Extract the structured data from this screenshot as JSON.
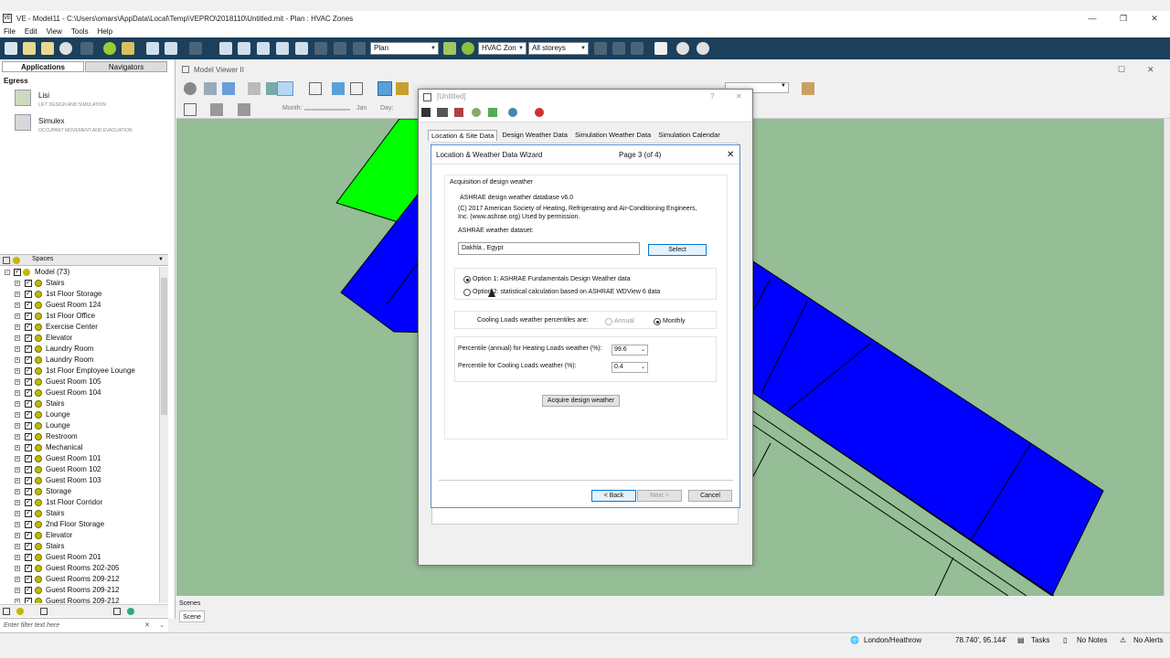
{
  "window": {
    "app_icon": "VE",
    "title": "VE - Model11 - C:\\Users\\omars\\AppData\\Local\\Temp\\VEPRO\\2018110\\Untitled.mit - Plan : HVAC Zones",
    "minimize": "—",
    "maximize": "❐",
    "close": "✕"
  },
  "menu": [
    "File",
    "Edit",
    "View",
    "Tools",
    "Help"
  ],
  "toolbar": {
    "view_select": "Plan",
    "layer_select": "HVAC Zon",
    "storey_select": "All storeys"
  },
  "left_panel": {
    "tabs": [
      "Applications",
      "Navigators"
    ],
    "group": "Egress",
    "apps": [
      {
        "name": "Lisi",
        "desc": "LIFT DESIGN AND SIMULATION"
      },
      {
        "name": "Simulex",
        "desc": "OCCUPANT MOVEMENT AND EVACUATION"
      }
    ],
    "spaces_label": "Spaces",
    "model_root": "Model (73)",
    "rooms": [
      "Stairs",
      "1st Floor Storage",
      "Guest Room 124",
      "1st Floor Office",
      "Exercise Center",
      "Elevator",
      "Laundry Room",
      "Laundry Room",
      "1st Floor Employee Lounge",
      "Guest Room 105",
      "Guest Room 104",
      "Stairs",
      "Lounge",
      "Lounge",
      "Restroom",
      "Mechanical",
      "Guest Room 101",
      "Guest Room 102",
      "Guest Room 103",
      "Storage",
      "1st Floor Corridor",
      "Stairs",
      "2nd Floor Storage",
      "Elevator",
      "Stairs",
      "Guest Room 201",
      "Guest Rooms 202-205",
      "Guest Rooms 209-212",
      "Guest Rooms 209-212",
      "Guest Rooms 209-212"
    ],
    "filter_placeholder": "Enter filter text here"
  },
  "model_viewer": {
    "title": "Model Viewer II",
    "month_label": "Month:",
    "month_value": "Jan",
    "day_label": "Day:",
    "scenes_label": "Scenes",
    "scene_tab": "Scene"
  },
  "dialog": {
    "title": "[Untitled]",
    "help": "?",
    "close": "✕",
    "tabs": [
      "Location & Site Data",
      "Design Weather Data",
      "Simulation Weather Data",
      "Simulation Calendar"
    ]
  },
  "wizard": {
    "title": "Location & Weather Data Wizard",
    "page": "Page 3 (of 4)",
    "close": "✕",
    "section": "Acquisition of design weather",
    "db_name": "ASHRAE design weather database v6.0",
    "copyright_1": "(C) 2017 American Society of Heating, Refrigerating and Air-Conditioning Engineers,",
    "copyright_2": "Inc. (www.ashrae.org)  Used by permission.",
    "dataset_label": "ASHRAE weather dataset:",
    "dataset_value": "Dakhla , Egypt",
    "select_button": "Select",
    "option1": "Option 1: ASHRAE Fundamentals Design Weather data",
    "option2": "Option 2: statistical calculation based on ASHRAE WDView 6 data",
    "cooling_label": "Cooling Loads weather percentiles are:",
    "annual": "Annual",
    "monthly": "Monthly",
    "heating_pct_label": "Percentile (annual) for Heating Loads weather (%):",
    "heating_pct_value": "99.6",
    "cooling_pct_label": "Percentile for Cooling Loads weather (%):",
    "cooling_pct_value": "0.4",
    "acquire_button": "Acquire design weather",
    "back_button": "< Back",
    "next_button": "Next >",
    "cancel_button": "Cancel"
  },
  "status": {
    "location": "London/Heathrow",
    "coords": "78.740', 95.144'",
    "tasks": "Tasks",
    "notes": "No Notes",
    "alerts": "No Alerts"
  },
  "colors": {
    "toolbar_bg": "#1c3f5c",
    "viewport_bg": "#95bd96",
    "zone_blue": "#0000ff",
    "zone_green": "#00ff00"
  }
}
